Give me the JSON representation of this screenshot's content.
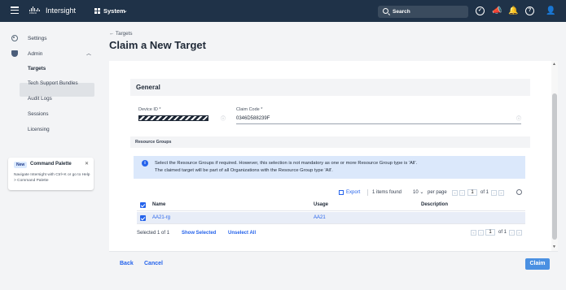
{
  "topbar": {
    "logo_word": "cisco",
    "brand": "Intersight",
    "context": "System",
    "search_label": "Search",
    "icons": [
      "menu-icon",
      "check-circle-icon",
      "megaphone-icon",
      "bell-icon",
      "help-icon",
      "user-icon"
    ]
  },
  "sidebar": {
    "settings_label": "Settings",
    "admin_label": "Admin",
    "sub_items": [
      "Targets",
      "Tech Support Bundles",
      "Audit Logs",
      "Sessions",
      "Licensing"
    ],
    "active_item": "Targets",
    "palette": {
      "badge": "New",
      "title": "Command Palette",
      "description": "Navigate Intersight with Ctrl+K or go to Help > Command Palette"
    }
  },
  "breadcrumb": "← Targets",
  "page_title": "Claim a New Target",
  "general": {
    "title": "General",
    "device_id_label": "Device ID *",
    "claim_code_label": "Claim Code *",
    "claim_code_value": "0346D588239F"
  },
  "resource_groups": {
    "title": "Resource Groups",
    "info": "Select the Resource Groups if required. However, this selection is not mandatory as one or more Resource Group type is 'All'. The claimed target will be part of all Organizations with the Resource Group type 'All'.",
    "toolbar": {
      "export": "Export",
      "items_found": "1 items found",
      "per_page_value": "10",
      "per_page_label": "per page",
      "page": "1",
      "of_label": "of 1"
    },
    "columns": [
      "Name",
      "Usage",
      "Description"
    ],
    "rows": [
      {
        "name": "AA21-rg",
        "usage": "AA21",
        "description": ""
      }
    ],
    "selected_text": "Selected 1 of 1",
    "show_selected": "Show Selected",
    "unselect_all": "Unselect All",
    "bottom_page": "1",
    "bottom_of": "of 1"
  },
  "footer": {
    "back": "Back",
    "cancel": "Cancel",
    "claim": "Claim"
  },
  "colors": {
    "topbar": "#1f3248",
    "accent": "#2563eb",
    "claim_button": "#4a90e2",
    "info_bg": "#dbe8fb"
  }
}
